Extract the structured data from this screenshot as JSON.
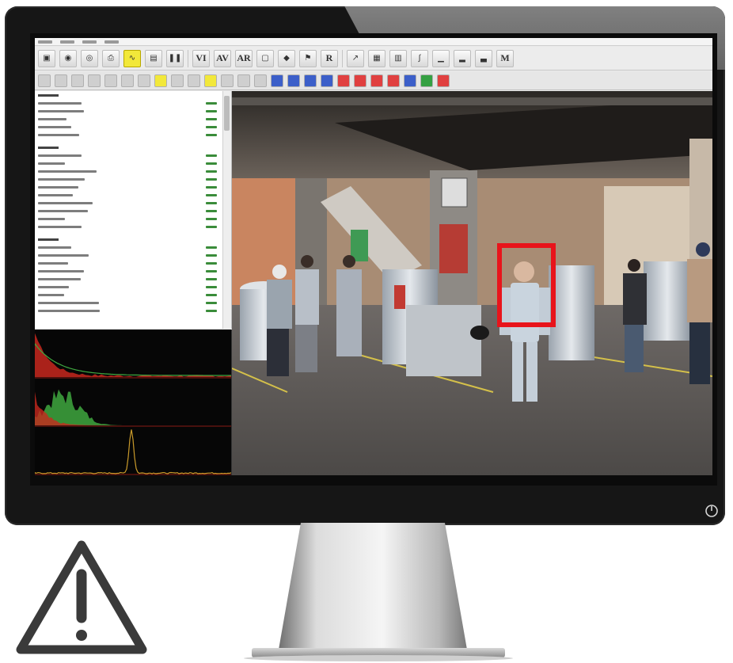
{
  "window": {
    "title": "",
    "menus": [
      {
        "label": ""
      },
      {
        "label": ""
      },
      {
        "label": ""
      },
      {
        "label": ""
      }
    ]
  },
  "toolbar": {
    "buttons": [
      {
        "icon": "save-icon"
      },
      {
        "icon": "camera-icon"
      },
      {
        "icon": "disc-icon"
      },
      {
        "icon": "print-icon"
      },
      {
        "icon": "wave-icon"
      },
      {
        "icon": "film-icon"
      },
      {
        "icon": "pause-icon"
      },
      {
        "label": "VI"
      },
      {
        "label": "AV"
      },
      {
        "label": "AR"
      },
      {
        "icon": "frame-icon"
      },
      {
        "icon": "auto-icon"
      },
      {
        "icon": "flag-icon"
      },
      {
        "label": "R"
      },
      {
        "icon": "chart-icon"
      },
      {
        "icon": "rgb-icon"
      },
      {
        "icon": "threshold-icon"
      },
      {
        "icon": "curve-icon"
      },
      {
        "icon": "green-mark-icon"
      },
      {
        "icon": "bar-icon"
      },
      {
        "icon": "red-mark-icon"
      },
      {
        "label": "M"
      }
    ],
    "active_index": 4,
    "accent": "#f2e83a"
  },
  "toolbar2": {
    "buttons": [
      {
        "label": "",
        "color": "gray"
      },
      {
        "label": "",
        "color": "gray"
      },
      {
        "label": "",
        "color": "gray"
      },
      {
        "label": "",
        "color": "gray"
      },
      {
        "label": "",
        "color": "gray"
      },
      {
        "label": "",
        "color": "gray"
      },
      {
        "label": "",
        "color": "gray"
      },
      {
        "label": "",
        "color": "yellow"
      },
      {
        "label": "",
        "color": "gray"
      },
      {
        "label": "",
        "color": "gray"
      },
      {
        "label": "",
        "color": "yellow"
      },
      {
        "label": "",
        "color": "gray"
      },
      {
        "label": "",
        "color": "gray"
      },
      {
        "label": "",
        "color": "gray"
      },
      {
        "label": "",
        "color": "blue"
      },
      {
        "label": "",
        "color": "blue"
      },
      {
        "label": "",
        "color": "blue"
      },
      {
        "label": "",
        "color": "blue"
      },
      {
        "label": "",
        "color": "red"
      },
      {
        "label": "",
        "color": "red"
      },
      {
        "label": "",
        "color": "red"
      },
      {
        "label": "",
        "color": "red"
      },
      {
        "label": "",
        "color": "blue"
      },
      {
        "label": "",
        "color": "green"
      },
      {
        "label": "",
        "color": "red"
      }
    ]
  },
  "sidebar": {
    "sections": [
      {
        "title": "",
        "rows": 5
      },
      {
        "title": "",
        "rows": 10
      },
      {
        "title": "",
        "rows": 9
      }
    ]
  },
  "detection": {
    "box_color": "#e8141b"
  },
  "histograms": {
    "colors": {
      "red": "#c8281e",
      "green": "#3fa840",
      "axis": "#8a1a14"
    }
  },
  "warning": {
    "icon": "warning-triangle-icon",
    "stroke": "#3a3a3a"
  }
}
